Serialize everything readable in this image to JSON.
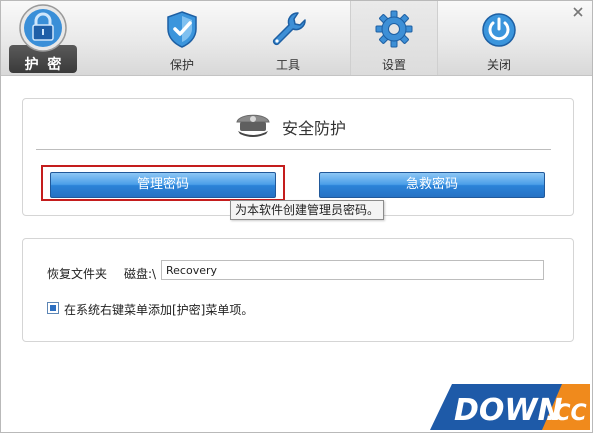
{
  "toolbar": {
    "tabs": [
      {
        "label": "护 密",
        "icon": "safe-lock-icon"
      },
      {
        "label": "保护",
        "icon": "shield-icon"
      },
      {
        "label": "工具",
        "icon": "wrench-icon"
      },
      {
        "label": "设置",
        "icon": "gear-icon"
      },
      {
        "label": "关闭",
        "icon": "power-icon"
      }
    ],
    "active_tab": "设置",
    "close_icon": "close-icon"
  },
  "security": {
    "title": "安全防护",
    "icon": "police-cap-icon",
    "manage_password_label": "管理密码",
    "rescue_password_label": "急救密码",
    "tooltip": "为本软件创建管理员密码。"
  },
  "recovery": {
    "folder_label": "恢复文件夹",
    "drive_label": "磁盘:\\",
    "folder_value": "Recovery",
    "context_menu_label": "在系统右键菜单添加[护密]菜单项。",
    "context_menu_checked": true
  },
  "watermark": {
    "text_main": "DOWN",
    "text_suffix": ".CC"
  },
  "colors": {
    "button_blue": "#2b83d8",
    "highlight_red": "#c41d1d",
    "watermark_blue": "#1e5aa8",
    "watermark_orange": "#f08a1c"
  }
}
